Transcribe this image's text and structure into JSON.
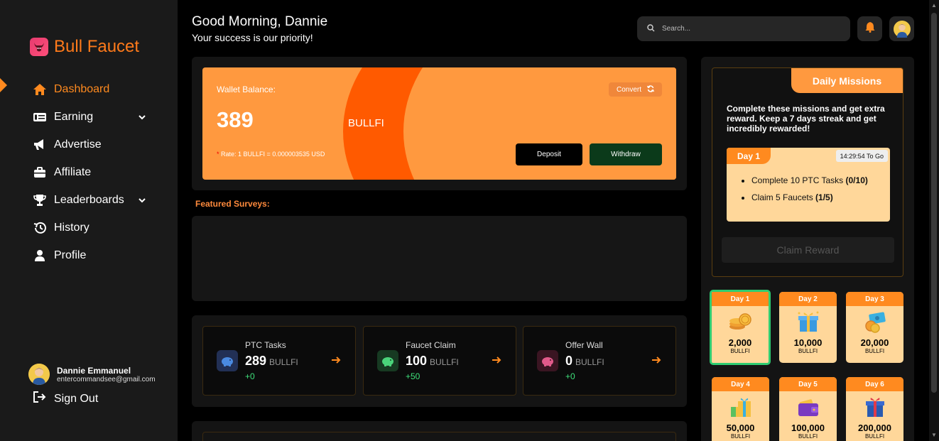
{
  "brand": {
    "name": "Bull Faucet"
  },
  "sidebar": {
    "items": [
      {
        "label": "Dashboard",
        "icon": "home-icon"
      },
      {
        "label": "Earning",
        "icon": "money-card-icon"
      },
      {
        "label": "Advertise",
        "icon": "megaphone-icon"
      },
      {
        "label": "Affiliate",
        "icon": "briefcase-icon"
      },
      {
        "label": "Leaderboards",
        "icon": "trophy-icon"
      },
      {
        "label": "History",
        "icon": "history-icon"
      },
      {
        "label": "Profile",
        "icon": "user-icon"
      }
    ],
    "user": {
      "name": "Dannie Emmanuel",
      "email": "entercommandsee@gmail.com"
    },
    "signout_label": "Sign Out"
  },
  "header": {
    "greeting": "Good Morning, Dannie",
    "subtitle": "Your success is our priority!",
    "search_placeholder": "Search..."
  },
  "wallet": {
    "label": "Wallet Balance:",
    "amount": "389",
    "unit": "BULLFI",
    "rate_star": "*",
    "rate": "Rate: 1 BULLFI = 0.000003535 USD",
    "convert_label": "Convert",
    "deposit_label": "Deposit",
    "withdraw_label": "Withdraw"
  },
  "featured_surveys": {
    "title": "Featured Surveys:"
  },
  "stats": [
    {
      "title": "PTC Tasks",
      "value": "289",
      "unit": "BULLFI",
      "delta": "+0",
      "color": "#3a4a8a"
    },
    {
      "title": "Faucet Claim",
      "value": "100",
      "unit": "BULLFI",
      "delta": "+50",
      "color": "#1e6a3a"
    },
    {
      "title": "Offer Wall",
      "value": "0",
      "unit": "BULLFI",
      "delta": "+0",
      "color": "#6a1e3a"
    }
  ],
  "missions": {
    "tab": "Daily Missions",
    "description": "Complete these missions and get extra reward. Keep a 7 days streak and get incredibly rewarded!",
    "day_label": "Day 1",
    "timer": "14:29:54 To Go",
    "tasks": [
      {
        "text": "Complete 10 PTC Tasks",
        "progress": "(0/10)"
      },
      {
        "text": "Claim 5 Faucets",
        "progress": "(1/5)"
      }
    ],
    "claim_label": "Claim Reward"
  },
  "days": [
    {
      "label": "Day 1",
      "amount": "2,000",
      "unit": "BULLFI",
      "icon": "coins-icon"
    },
    {
      "label": "Day 2",
      "amount": "10,000",
      "unit": "BULLFI",
      "icon": "gift-box-icon"
    },
    {
      "label": "Day 3",
      "amount": "20,000",
      "unit": "BULLFI",
      "icon": "cash-icon"
    },
    {
      "label": "Day 4",
      "amount": "50,000",
      "unit": "BULLFI",
      "icon": "gifts-icon"
    },
    {
      "label": "Day 5",
      "amount": "100,000",
      "unit": "BULLFI",
      "icon": "wallet-icon"
    },
    {
      "label": "Day 6",
      "amount": "200,000",
      "unit": "BULLFI",
      "icon": "present-icon"
    }
  ],
  "colors": {
    "accent": "#ff8a1f",
    "wallet_bg": "#ff993f",
    "wallet_arc": "#ff5a00",
    "success": "#3ee07a"
  }
}
